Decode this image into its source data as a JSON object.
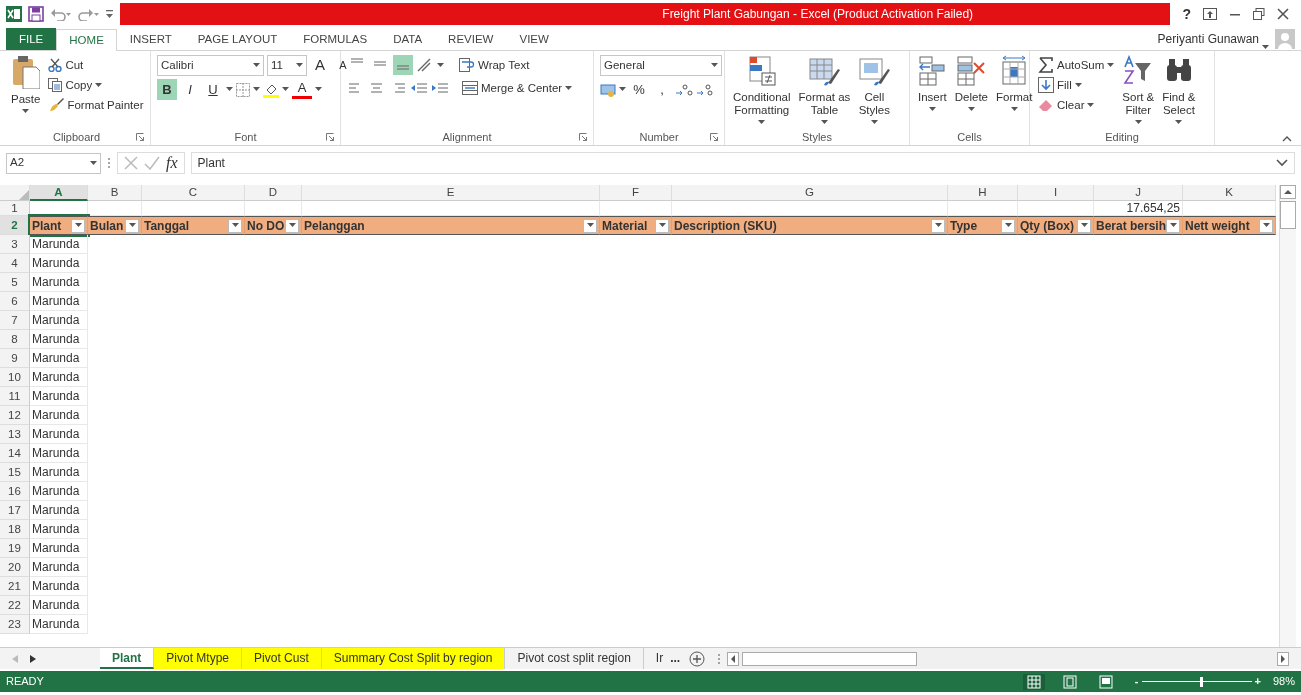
{
  "window": {
    "title": "Freight Plant Gabungan -  Excel (Product Activation Failed)",
    "help": "?"
  },
  "menu_tabs": [
    {
      "label": "FILE",
      "kind": "file",
      "selected": false
    },
    {
      "label": "HOME",
      "kind": "tab",
      "selected": true
    },
    {
      "label": "INSERT",
      "kind": "tab",
      "selected": false
    },
    {
      "label": "PAGE LAYOUT",
      "kind": "tab",
      "selected": false
    },
    {
      "label": "FORMULAS",
      "kind": "tab",
      "selected": false
    },
    {
      "label": "DATA",
      "kind": "tab",
      "selected": false
    },
    {
      "label": "REVIEW",
      "kind": "tab",
      "selected": false
    },
    {
      "label": "VIEW",
      "kind": "tab",
      "selected": false
    }
  ],
  "user": {
    "name": "Periyanti Gunawan"
  },
  "ribbon": {
    "clipboard": {
      "label": "Clipboard",
      "paste": "Paste",
      "items": [
        "Cut",
        "Copy",
        "Format Painter"
      ]
    },
    "font": {
      "label": "Font",
      "font_name": "Calibri",
      "font_size": "11",
      "grow": "A",
      "shrink": "A",
      "styles": [
        {
          "label": "B",
          "selected": true
        },
        {
          "label": "I",
          "selected": false
        },
        {
          "label": "U",
          "selected": false
        }
      ],
      "font_color": "A"
    },
    "alignment": {
      "label": "Alignment",
      "vertical_align": [
        {
          "selected": false
        },
        {
          "selected": false
        },
        {
          "selected": true
        }
      ],
      "wrap": "Wrap Text",
      "merge": "Merge & Center"
    },
    "number": {
      "label": "Number",
      "format": "General",
      "percent": "%",
      "comma": ","
    },
    "styles": {
      "label": "Styles",
      "buttons": [
        "Conditional\nFormatting",
        "Format as\nTable",
        "Cell\nStyles"
      ]
    },
    "cells": {
      "label": "Cells",
      "buttons": [
        "Insert",
        "Delete",
        "Format"
      ]
    },
    "editing": {
      "label": "Editing",
      "small": [
        "AutoSum",
        "Fill",
        "Clear"
      ],
      "big": [
        "Sort &\nFilter",
        "Find &\nSelect"
      ]
    }
  },
  "formula_bar": {
    "name_box": "A2",
    "fx": "fx",
    "formula": "Plant"
  },
  "sheet": {
    "columns": [
      {
        "label": "A",
        "selected": true
      },
      {
        "label": "B",
        "selected": false
      },
      {
        "label": "C",
        "selected": false
      },
      {
        "label": "D",
        "selected": false
      },
      {
        "label": "E",
        "selected": false
      },
      {
        "label": "F",
        "selected": false
      },
      {
        "label": "G",
        "selected": false
      },
      {
        "label": "H",
        "selected": false
      },
      {
        "label": "I",
        "selected": false
      },
      {
        "label": "J",
        "selected": false
      },
      {
        "label": "K",
        "selected": false
      }
    ],
    "total_row": {
      "number": "1",
      "selected": false,
      "total": "17.654,25"
    },
    "header_row": {
      "number": "2",
      "selected": true,
      "cells": [
        "Plant",
        "Bulan",
        "Tanggal",
        "No DO",
        "Pelanggan",
        "Material",
        "Description (SKU)",
        "Type",
        "Qty (Box)",
        "Berat bersih",
        "Nett weight"
      ]
    },
    "rows": [
      {
        "number": "3",
        "plant": "Marunda"
      },
      {
        "number": "4",
        "plant": "Marunda"
      },
      {
        "number": "5",
        "plant": "Marunda"
      },
      {
        "number": "6",
        "plant": "Marunda"
      },
      {
        "number": "7",
        "plant": "Marunda"
      },
      {
        "number": "8",
        "plant": "Marunda"
      },
      {
        "number": "9",
        "plant": "Marunda"
      },
      {
        "number": "10",
        "plant": "Marunda"
      },
      {
        "number": "11",
        "plant": "Marunda"
      },
      {
        "number": "12",
        "plant": "Marunda"
      },
      {
        "number": "13",
        "plant": "Marunda"
      },
      {
        "number": "14",
        "plant": "Marunda"
      },
      {
        "number": "15",
        "plant": "Marunda"
      },
      {
        "number": "16",
        "plant": "Marunda"
      },
      {
        "number": "17",
        "plant": "Marunda"
      },
      {
        "number": "18",
        "plant": "Marunda"
      },
      {
        "number": "19",
        "plant": "Marunda"
      },
      {
        "number": "20",
        "plant": "Marunda"
      },
      {
        "number": "21",
        "plant": "Marunda"
      },
      {
        "number": "22",
        "plant": "Marunda"
      },
      {
        "number": "23",
        "plant": "Marunda"
      }
    ]
  },
  "sheet_tabs": [
    {
      "label": "Plant",
      "selected": true
    },
    {
      "label": "Pivot Mtype",
      "selected": false,
      "color": "#ffff00"
    },
    {
      "label": "Pivot Cust",
      "selected": false,
      "color": "#ffff00"
    },
    {
      "label": "Summary Cost Split by region",
      "selected": false,
      "color": "#ffff00"
    },
    {
      "label": "Pivot cost split region",
      "selected": false
    },
    {
      "label": "Ir",
      "selected": false
    }
  ],
  "more_tabs": "...",
  "status_bar": {
    "status": "READY",
    "views": [
      {
        "selected": true
      },
      {
        "selected": false
      },
      {
        "selected": false
      }
    ],
    "zoom": {
      "minus": "-",
      "plus": "+",
      "level": 0.53,
      "reading": "98%"
    }
  }
}
